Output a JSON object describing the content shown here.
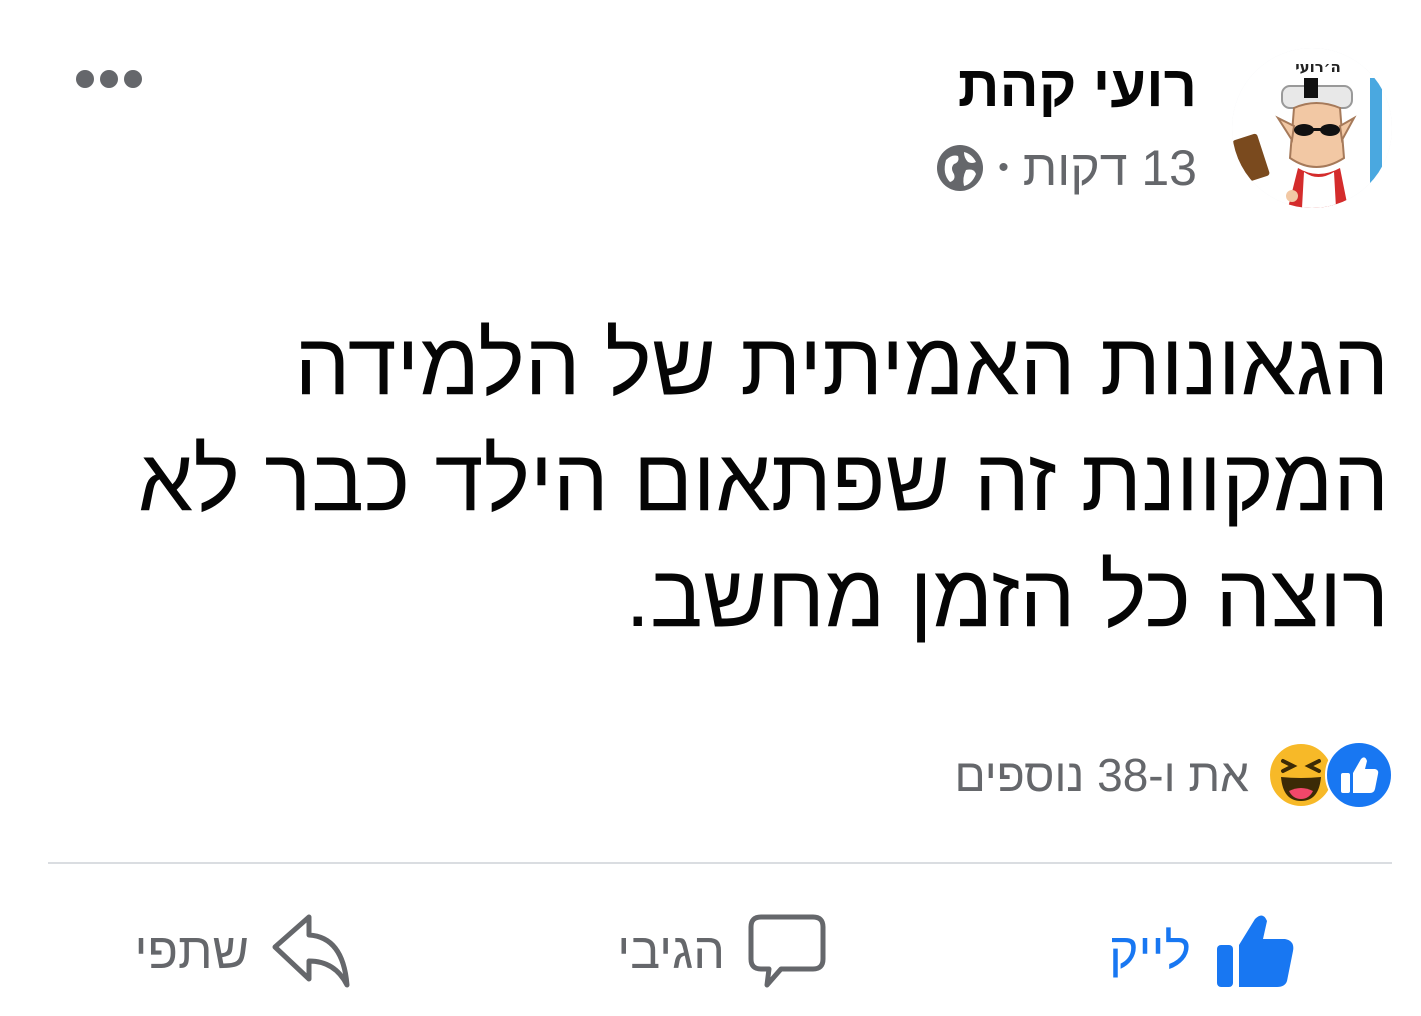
{
  "post": {
    "author": "רועי קהת",
    "time": "13 דקות",
    "separator": "•",
    "privacy_icon": "globe-icon",
    "avatar_caption": "ה׳רועי",
    "text": "הגאונות האמיתית של הלמידה\nהמקוונת זה שפתאום הילד כבר לא\nרוצה כל הזמן מחשב."
  },
  "reactions": {
    "icons": [
      "like-reaction-icon",
      "haha-reaction-icon"
    ],
    "summary": "את ו-38 נוספים"
  },
  "actions": {
    "like": "לייק",
    "comment": "הגיבי",
    "share": "שתפי"
  },
  "colors": {
    "accent": "#1877f2",
    "text": "#050505",
    "secondary": "#65676b",
    "divider": "#dadde1",
    "haha": "#f7b928"
  }
}
